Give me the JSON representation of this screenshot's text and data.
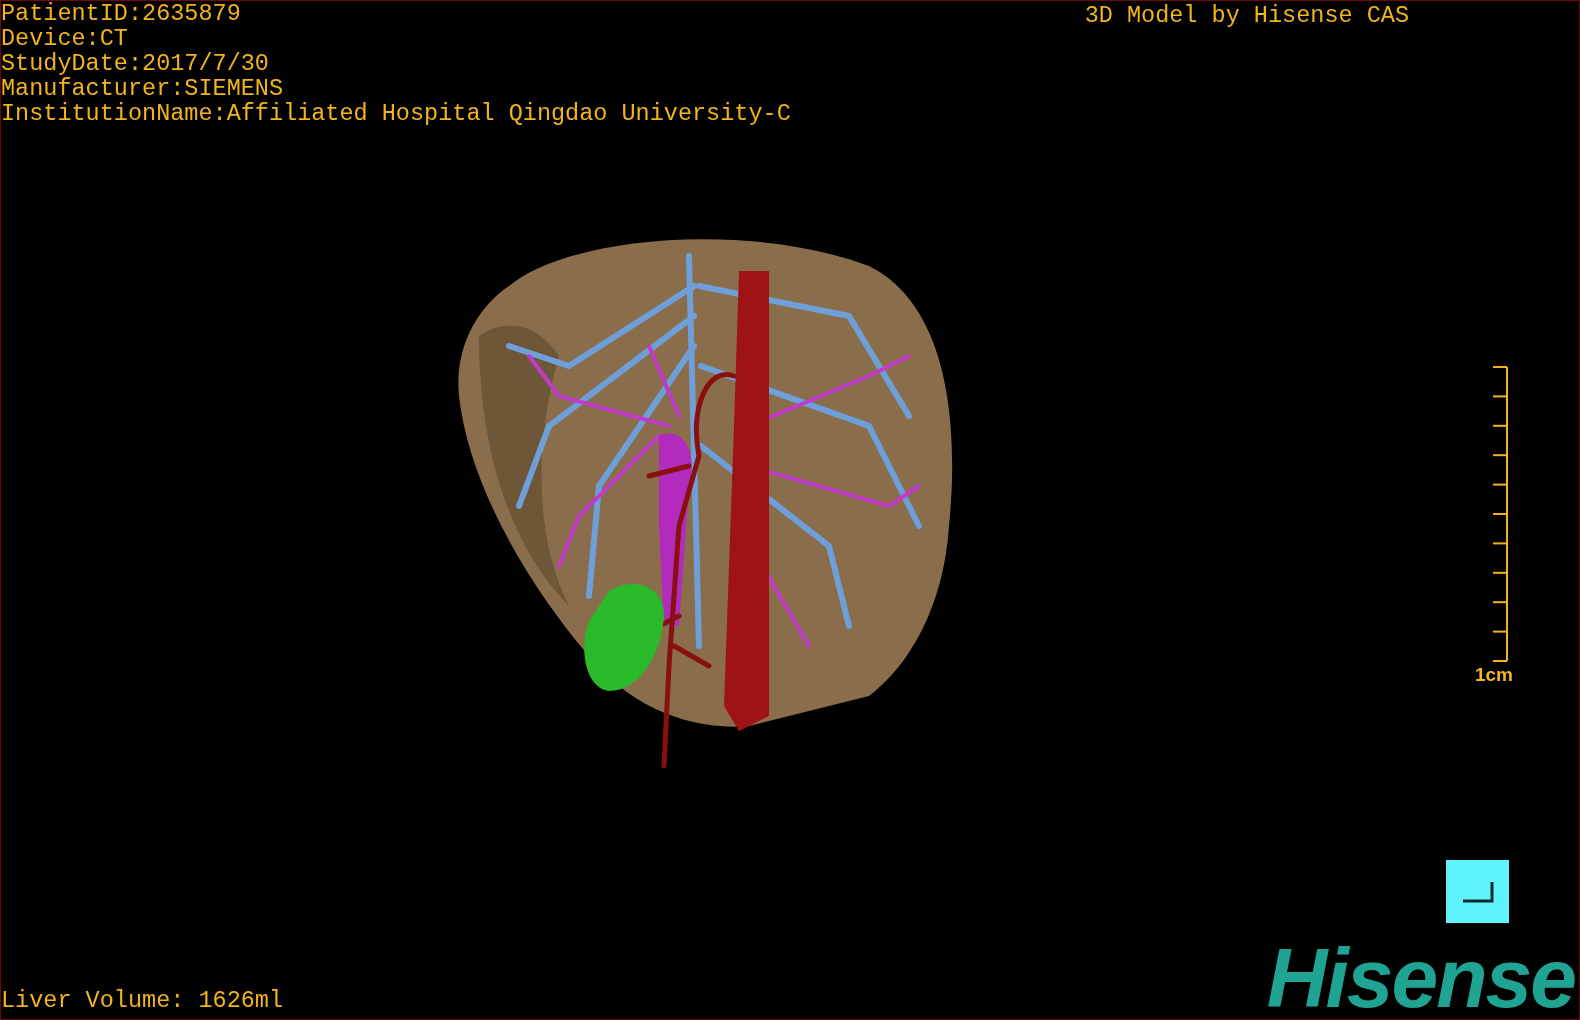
{
  "patient_info": [
    "PatientID:2635879",
    "Device:CT",
    "StudyDate:2017/7/30",
    "Manufacturer:SIEMENS",
    "InstitutionName:Affiliated Hospital Qingdao University-C"
  ],
  "title": "3D Model by Hisense CAS",
  "scale_bar": {
    "label": "1cm"
  },
  "liver_volume": "Liver Volume: 1626ml",
  "logo": "Hisense"
}
